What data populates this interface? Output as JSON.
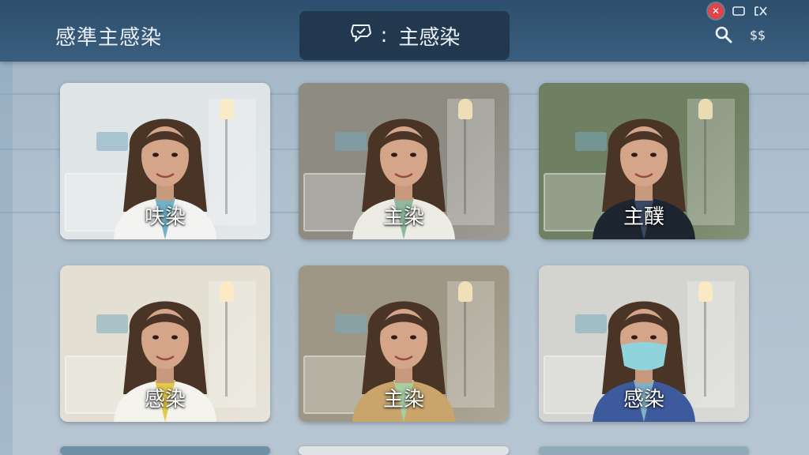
{
  "header": {
    "title": "感準主感染",
    "center_selector": {
      "icon": "chat-badge-icon",
      "separator": ":",
      "label": "主感染"
    },
    "window_controls": [
      "close-icon",
      "restore-icon",
      "minimize-icon"
    ],
    "tools": [
      "search-icon",
      "currency-icon"
    ]
  },
  "grid": {
    "cards": [
      {
        "label": "呋染",
        "tint": "#dfe4e6",
        "coat": "#f3f4f2",
        "shirt": "#6fb3c6",
        "mask": false
      },
      {
        "label": "主染",
        "tint": "#8d8b82",
        "coat": "#ecebe4",
        "shirt": "#8fb8a0",
        "mask": false
      },
      {
        "label": "主醭",
        "tint": "#6f7f61",
        "coat": "#1d2530",
        "shirt": "#3a4a66",
        "mask": false
      },
      {
        "label": "感染",
        "tint": "#e3dfd2",
        "coat": "#f4f3ee",
        "shirt": "#e3c94b",
        "mask": false
      },
      {
        "label": "主染",
        "tint": "#9e9785",
        "coat": "#c9a56b",
        "shirt": "#a8cfa2",
        "mask": false
      },
      {
        "label": "感染",
        "tint": "#d3d4cf",
        "coat": "#3d5a9c",
        "shirt": "#7fb2c7",
        "mask": true
      }
    ],
    "partial_row_tints": [
      "#6e8fa6",
      "#dfe3e6",
      "#8faab8"
    ]
  },
  "colors": {
    "topbar": "#34587a",
    "pill": "#21384f",
    "close": "#e04449"
  }
}
